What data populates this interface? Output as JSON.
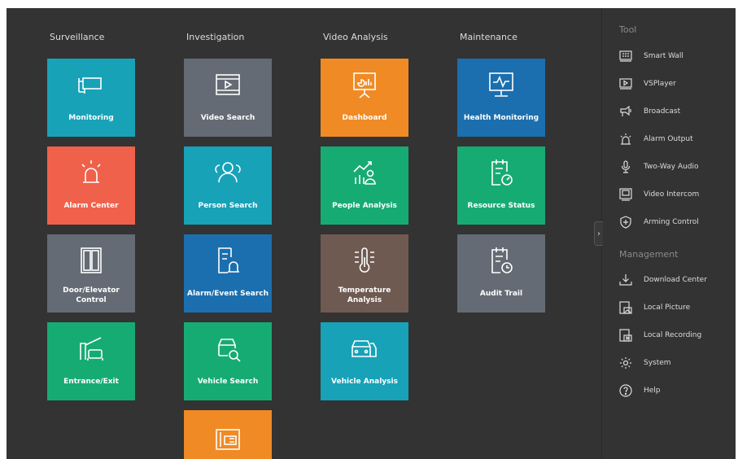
{
  "columns": [
    "Surveillance",
    "Investigation",
    "Video Analysis",
    "Maintenance"
  ],
  "tiles": {
    "monitoring": {
      "label": "Monitoring",
      "color": "#17a2b8"
    },
    "alarm_center": {
      "label": "Alarm Center",
      "color": "#f0614b"
    },
    "door_elevator": {
      "label": "Door/Elevator Control",
      "color": "#646b74"
    },
    "entrance_exit": {
      "label": "Entrance/Exit",
      "color": "#17ab74"
    },
    "video_search": {
      "label": "Video Search",
      "color": "#646b74"
    },
    "person_search": {
      "label": "Person Search",
      "color": "#17a2b8"
    },
    "alarm_event_search": {
      "label": "Alarm/Event Search",
      "color": "#1c6fae"
    },
    "vehicle_search": {
      "label": "Vehicle Search",
      "color": "#17ab74"
    },
    "partial_tile": {
      "label": "",
      "color": "#f08a24"
    },
    "dashboard": {
      "label": "Dashboard",
      "color": "#f08a24"
    },
    "people_analysis": {
      "label": "People Analysis",
      "color": "#17ab74"
    },
    "temperature_analysis": {
      "label": "Temperature Analysis",
      "color": "#6f5a52"
    },
    "vehicle_analysis": {
      "label": "Vehicle Analysis",
      "color": "#17a2b8"
    },
    "health_monitoring": {
      "label": "Health Monitoring",
      "color": "#1c6fae"
    },
    "resource_status": {
      "label": "Resource Status",
      "color": "#17ab74"
    },
    "audit_trail": {
      "label": "Audit Trail",
      "color": "#646b74"
    }
  },
  "sidebar": {
    "tool_title": "Tool",
    "tool_items": [
      {
        "label": "Smart Wall",
        "icon": "smart-wall-icon"
      },
      {
        "label": "VSPlayer",
        "icon": "player-icon"
      },
      {
        "label": "Broadcast",
        "icon": "broadcast-icon"
      },
      {
        "label": "Alarm Output",
        "icon": "alarm-output-icon"
      },
      {
        "label": "Two-Way Audio",
        "icon": "microphone-icon"
      },
      {
        "label": "Video Intercom",
        "icon": "intercom-icon"
      },
      {
        "label": "Arming Control",
        "icon": "shield-icon"
      }
    ],
    "management_title": "Management",
    "management_items": [
      {
        "label": "Download Center",
        "icon": "download-icon"
      },
      {
        "label": "Local Picture",
        "icon": "picture-icon"
      },
      {
        "label": "Local Recording",
        "icon": "recording-icon"
      },
      {
        "label": "System",
        "icon": "gear-icon"
      },
      {
        "label": "Help",
        "icon": "help-icon"
      }
    ]
  },
  "colors": {
    "background": "#333333",
    "text": "#dcdcdc",
    "muted": "#8a8a8a"
  }
}
